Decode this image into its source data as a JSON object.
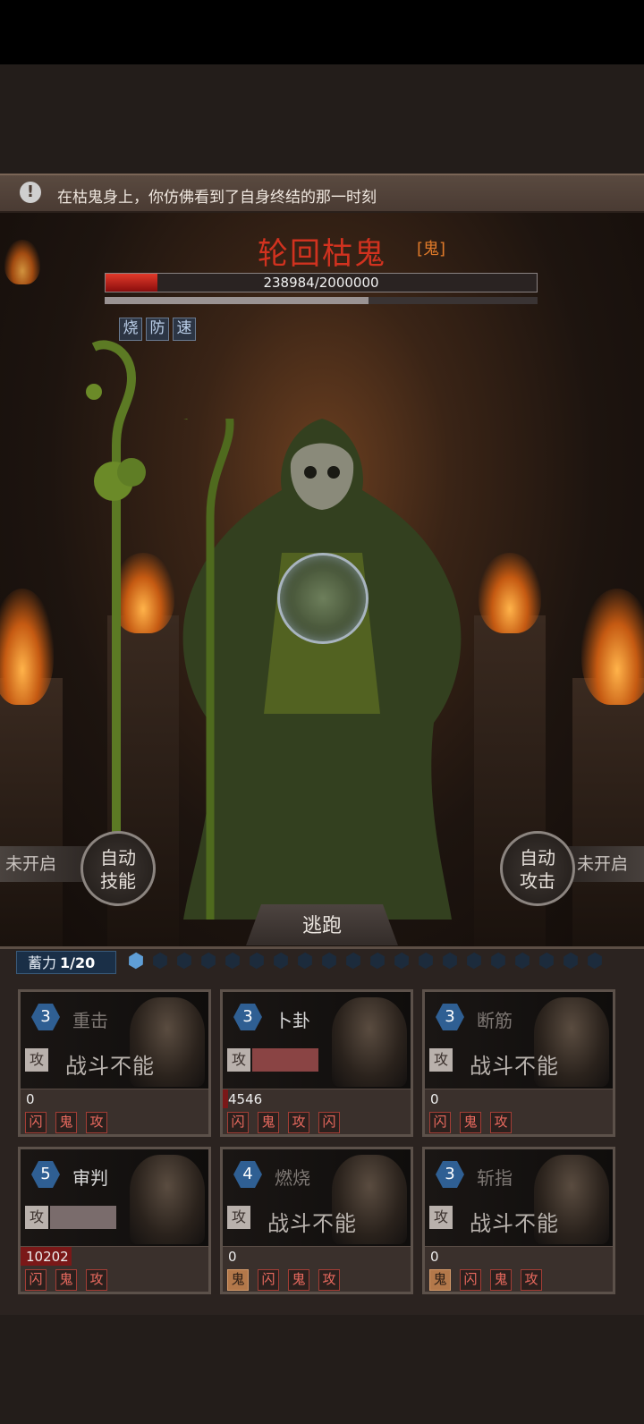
{
  "notice": {
    "icon": "exclamation-icon",
    "text": "在枯鬼身上，你仿佛看到了自身终结的那一时刻"
  },
  "boss": {
    "name": "轮回枯鬼",
    "tag": "[鬼]",
    "hp_text": "238984/2000000",
    "hp_fraction": 0.12,
    "secondary_fraction": 0.61,
    "buffs": [
      "烧",
      "防",
      "速"
    ]
  },
  "controls": {
    "left_status": "未开启",
    "auto_skill": "自动技能",
    "auto_skill_line1": "自动",
    "auto_skill_line2": "技能",
    "right_status": "未开启",
    "auto_attack_line1": "自动",
    "auto_attack_line2": "攻击",
    "flee": "逃跑"
  },
  "charge": {
    "label": "蓄力",
    "value": "1/20",
    "filled": 1,
    "total": 20
  },
  "cards": [
    {
      "level": "3",
      "skill": "重击",
      "dim": true,
      "attack": "攻",
      "disabled": "战斗不能",
      "gauge": 0,
      "value": "0",
      "value_fraction": 0,
      "tags": [
        "闪",
        "鬼",
        "攻"
      ],
      "gold": []
    },
    {
      "level": "3",
      "skill": "卜卦",
      "dim": false,
      "attack": "攻",
      "disabled": "",
      "gauge": 1.0,
      "gauge_color": "#8a4444",
      "value": "4546",
      "value_fraction": 0.03,
      "tags": [
        "闪",
        "鬼",
        "攻",
        "闪"
      ],
      "gold": []
    },
    {
      "level": "3",
      "skill": "断筋",
      "dim": true,
      "attack": "攻",
      "disabled": "战斗不能",
      "gauge": 0,
      "value": "0",
      "value_fraction": 0,
      "tags": [
        "闪",
        "鬼",
        "攻"
      ],
      "gold": []
    },
    {
      "level": "5",
      "skill": "审判",
      "dim": false,
      "attack": "攻",
      "disabled": "",
      "gauge": 1.0,
      "gauge_color": "#7a6c6c",
      "value": "10202",
      "value_fraction": 0.27,
      "tags": [
        "闪",
        "鬼",
        "攻"
      ],
      "gold": []
    },
    {
      "level": "4",
      "skill": "燃烧",
      "dim": true,
      "attack": "攻",
      "disabled": "战斗不能",
      "gauge": 0,
      "value": "0",
      "value_fraction": 0,
      "tags": [
        "鬼",
        "闪",
        "鬼",
        "攻"
      ],
      "gold": [
        0
      ]
    },
    {
      "level": "3",
      "skill": "斩指",
      "dim": true,
      "attack": "攻",
      "disabled": "战斗不能",
      "gauge": 0,
      "value": "0",
      "value_fraction": 0,
      "tags": [
        "鬼",
        "闪",
        "鬼",
        "攻"
      ],
      "gold": [
        0
      ]
    }
  ]
}
